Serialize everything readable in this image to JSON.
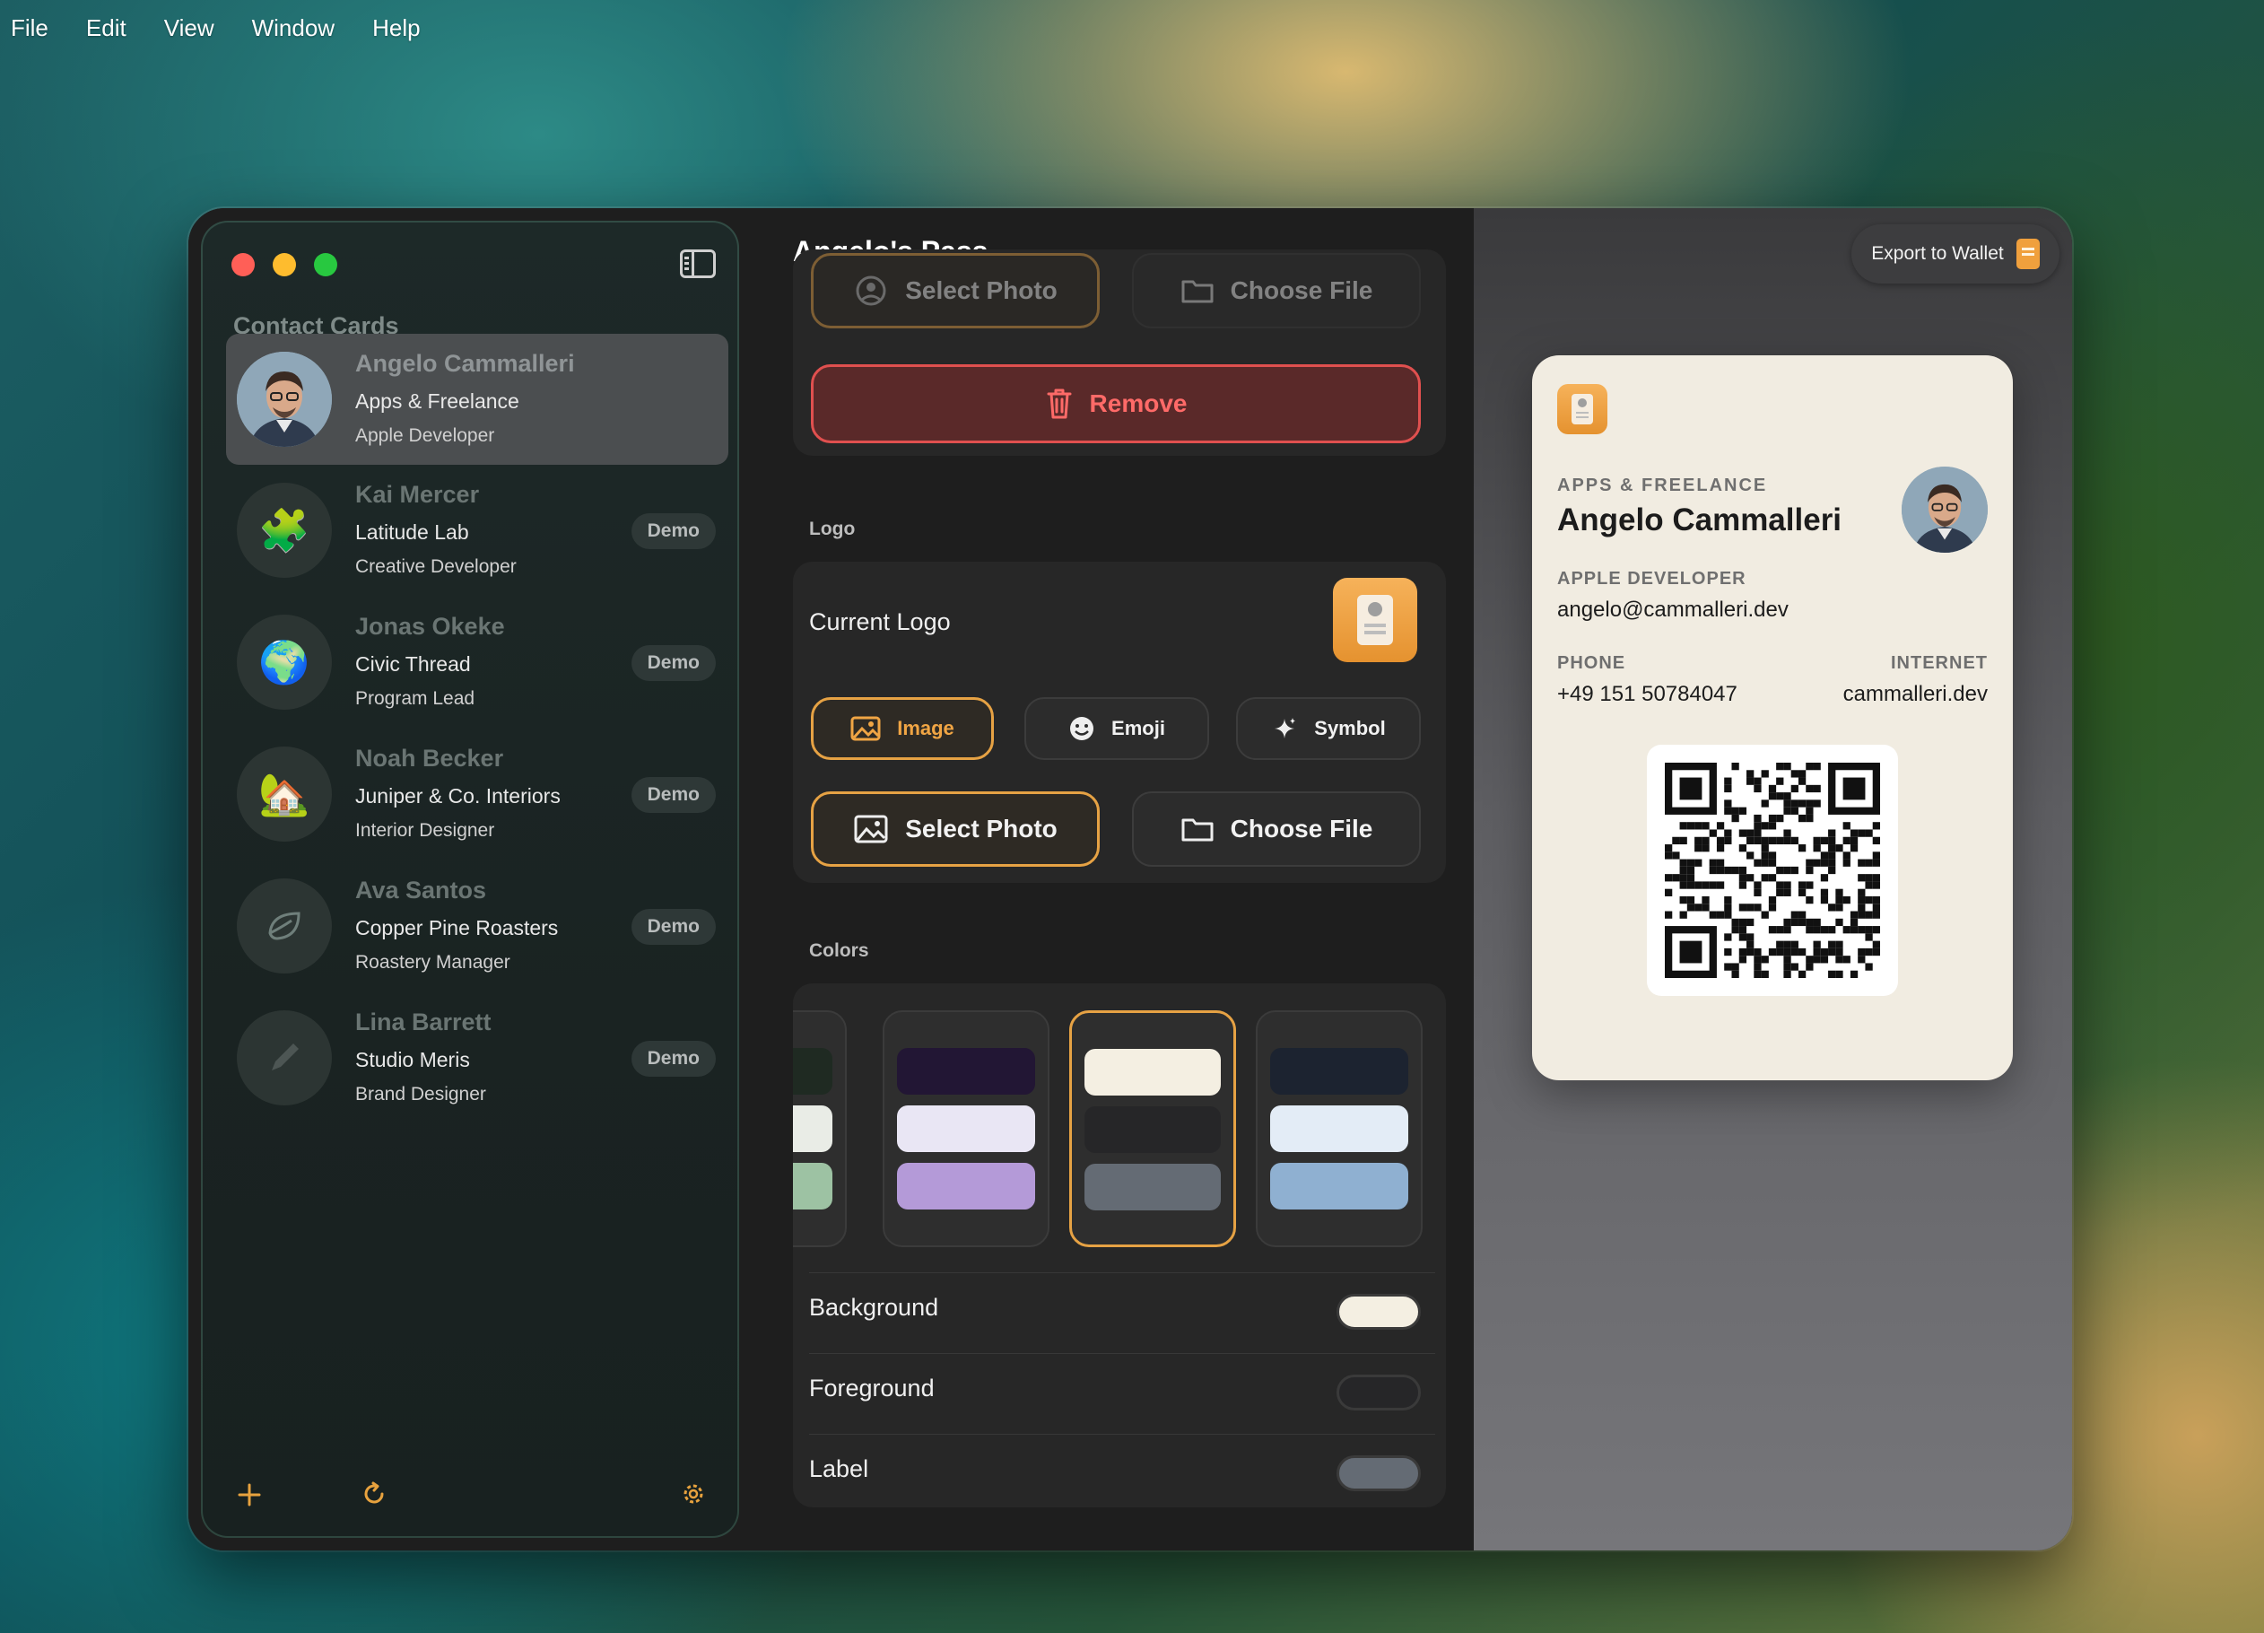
{
  "menubar": {
    "items": [
      "File",
      "Edit",
      "View",
      "Window",
      "Help"
    ]
  },
  "sidebar": {
    "section_title": "Contact Cards",
    "contacts": [
      {
        "name": "Angelo Cammalleri",
        "company": "Apps & Freelance",
        "role": "Apple Developer",
        "badge": "",
        "avatar": "photo"
      },
      {
        "name": "Kai Mercer",
        "company": "Latitude Lab",
        "role": "Creative Developer",
        "badge": "Demo",
        "avatar": "🧩"
      },
      {
        "name": "Jonas Okeke",
        "company": "Civic Thread",
        "role": "Program Lead",
        "badge": "Demo",
        "avatar": "🌍"
      },
      {
        "name": "Noah Becker",
        "company": "Juniper & Co. Interiors",
        "role": "Interior Designer",
        "badge": "Demo",
        "avatar": "🏡"
      },
      {
        "name": "Ava Santos",
        "company": "Copper Pine Roasters",
        "role": "Roastery Manager",
        "badge": "Demo",
        "avatar": "leaf-icon"
      },
      {
        "name": "Lina Barrett",
        "company": "Studio Meris",
        "role": "Brand Designer",
        "badge": "Demo",
        "avatar": "pen-icon"
      }
    ],
    "footer_icons": [
      "plus-icon",
      "refresh-icon",
      "gear-icon"
    ]
  },
  "main": {
    "title": "Angelo's Pass",
    "photo_section": {
      "select_photo": "Select Photo",
      "choose_file": "Choose File",
      "remove": "Remove"
    },
    "logo_section": {
      "label": "Logo",
      "current_logo": "Current Logo",
      "modes": [
        "Image",
        "Emoji",
        "Symbol"
      ],
      "selected_mode": "Image",
      "select_photo": "Select Photo",
      "choose_file": "Choose File"
    },
    "colors_section": {
      "label": "Colors",
      "presets": [
        {
          "bars": [
            "#1f2a22",
            "#e9ece6",
            "#9dc2a3"
          ]
        },
        {
          "bars": [
            "#221634",
            "#e9e6f4",
            "#b49ad8"
          ]
        },
        {
          "bars": [
            "#f4efe2",
            "#262628",
            "#646b74"
          ],
          "selected": true
        },
        {
          "bars": [
            "#1c2330",
            "#e3ecf6",
            "#8fb0d1"
          ]
        }
      ],
      "rows": [
        {
          "label": "Background",
          "color": "#f4efe2"
        },
        {
          "label": "Foreground",
          "color": "#262628"
        },
        {
          "label": "Label",
          "color": "#646b74"
        }
      ]
    }
  },
  "preview": {
    "export_label": "Export to Wallet",
    "pass": {
      "org_label": "APPS & FREELANCE",
      "name": "Angelo Cammalleri",
      "title_label": "APPLE DEVELOPER",
      "email": "angelo@cammalleri.dev",
      "phone_label": "PHONE",
      "phone": "+49 151 50784047",
      "internet_label": "INTERNET",
      "internet": "cammalleri.dev"
    }
  },
  "colors": {
    "accent": "#e6a244",
    "danger": "#e0504f",
    "pass_background": "#f1ece1"
  }
}
